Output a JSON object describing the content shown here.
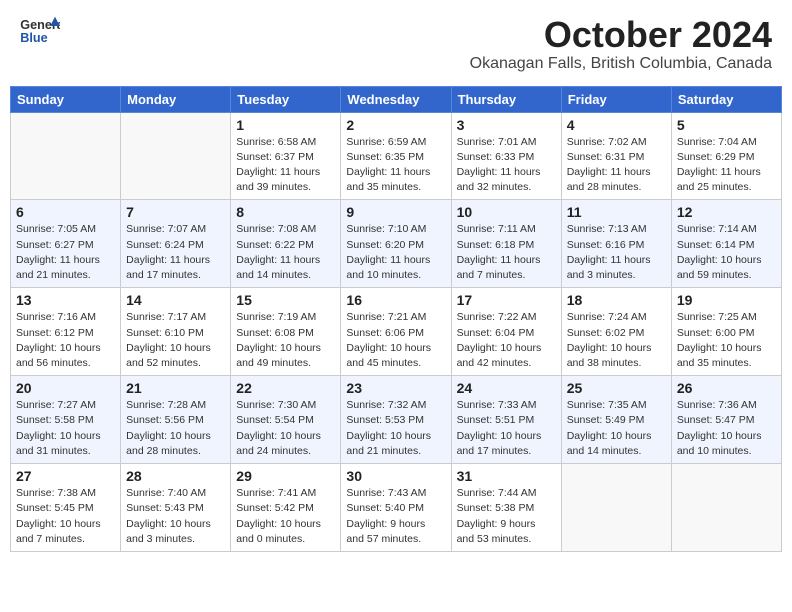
{
  "header": {
    "logo_general": "General",
    "logo_blue": "Blue",
    "month_title": "October 2024",
    "location": "Okanagan Falls, British Columbia, Canada"
  },
  "days_of_week": [
    "Sunday",
    "Monday",
    "Tuesday",
    "Wednesday",
    "Thursday",
    "Friday",
    "Saturday"
  ],
  "weeks": [
    [
      {
        "day": "",
        "info": ""
      },
      {
        "day": "",
        "info": ""
      },
      {
        "day": "1",
        "info": "Sunrise: 6:58 AM\nSunset: 6:37 PM\nDaylight: 11 hours and 39 minutes."
      },
      {
        "day": "2",
        "info": "Sunrise: 6:59 AM\nSunset: 6:35 PM\nDaylight: 11 hours and 35 minutes."
      },
      {
        "day": "3",
        "info": "Sunrise: 7:01 AM\nSunset: 6:33 PM\nDaylight: 11 hours and 32 minutes."
      },
      {
        "day": "4",
        "info": "Sunrise: 7:02 AM\nSunset: 6:31 PM\nDaylight: 11 hours and 28 minutes."
      },
      {
        "day": "5",
        "info": "Sunrise: 7:04 AM\nSunset: 6:29 PM\nDaylight: 11 hours and 25 minutes."
      }
    ],
    [
      {
        "day": "6",
        "info": "Sunrise: 7:05 AM\nSunset: 6:27 PM\nDaylight: 11 hours and 21 minutes."
      },
      {
        "day": "7",
        "info": "Sunrise: 7:07 AM\nSunset: 6:24 PM\nDaylight: 11 hours and 17 minutes."
      },
      {
        "day": "8",
        "info": "Sunrise: 7:08 AM\nSunset: 6:22 PM\nDaylight: 11 hours and 14 minutes."
      },
      {
        "day": "9",
        "info": "Sunrise: 7:10 AM\nSunset: 6:20 PM\nDaylight: 11 hours and 10 minutes."
      },
      {
        "day": "10",
        "info": "Sunrise: 7:11 AM\nSunset: 6:18 PM\nDaylight: 11 hours and 7 minutes."
      },
      {
        "day": "11",
        "info": "Sunrise: 7:13 AM\nSunset: 6:16 PM\nDaylight: 11 hours and 3 minutes."
      },
      {
        "day": "12",
        "info": "Sunrise: 7:14 AM\nSunset: 6:14 PM\nDaylight: 10 hours and 59 minutes."
      }
    ],
    [
      {
        "day": "13",
        "info": "Sunrise: 7:16 AM\nSunset: 6:12 PM\nDaylight: 10 hours and 56 minutes."
      },
      {
        "day": "14",
        "info": "Sunrise: 7:17 AM\nSunset: 6:10 PM\nDaylight: 10 hours and 52 minutes."
      },
      {
        "day": "15",
        "info": "Sunrise: 7:19 AM\nSunset: 6:08 PM\nDaylight: 10 hours and 49 minutes."
      },
      {
        "day": "16",
        "info": "Sunrise: 7:21 AM\nSunset: 6:06 PM\nDaylight: 10 hours and 45 minutes."
      },
      {
        "day": "17",
        "info": "Sunrise: 7:22 AM\nSunset: 6:04 PM\nDaylight: 10 hours and 42 minutes."
      },
      {
        "day": "18",
        "info": "Sunrise: 7:24 AM\nSunset: 6:02 PM\nDaylight: 10 hours and 38 minutes."
      },
      {
        "day": "19",
        "info": "Sunrise: 7:25 AM\nSunset: 6:00 PM\nDaylight: 10 hours and 35 minutes."
      }
    ],
    [
      {
        "day": "20",
        "info": "Sunrise: 7:27 AM\nSunset: 5:58 PM\nDaylight: 10 hours and 31 minutes."
      },
      {
        "day": "21",
        "info": "Sunrise: 7:28 AM\nSunset: 5:56 PM\nDaylight: 10 hours and 28 minutes."
      },
      {
        "day": "22",
        "info": "Sunrise: 7:30 AM\nSunset: 5:54 PM\nDaylight: 10 hours and 24 minutes."
      },
      {
        "day": "23",
        "info": "Sunrise: 7:32 AM\nSunset: 5:53 PM\nDaylight: 10 hours and 21 minutes."
      },
      {
        "day": "24",
        "info": "Sunrise: 7:33 AM\nSunset: 5:51 PM\nDaylight: 10 hours and 17 minutes."
      },
      {
        "day": "25",
        "info": "Sunrise: 7:35 AM\nSunset: 5:49 PM\nDaylight: 10 hours and 14 minutes."
      },
      {
        "day": "26",
        "info": "Sunrise: 7:36 AM\nSunset: 5:47 PM\nDaylight: 10 hours and 10 minutes."
      }
    ],
    [
      {
        "day": "27",
        "info": "Sunrise: 7:38 AM\nSunset: 5:45 PM\nDaylight: 10 hours and 7 minutes."
      },
      {
        "day": "28",
        "info": "Sunrise: 7:40 AM\nSunset: 5:43 PM\nDaylight: 10 hours and 3 minutes."
      },
      {
        "day": "29",
        "info": "Sunrise: 7:41 AM\nSunset: 5:42 PM\nDaylight: 10 hours and 0 minutes."
      },
      {
        "day": "30",
        "info": "Sunrise: 7:43 AM\nSunset: 5:40 PM\nDaylight: 9 hours and 57 minutes."
      },
      {
        "day": "31",
        "info": "Sunrise: 7:44 AM\nSunset: 5:38 PM\nDaylight: 9 hours and 53 minutes."
      },
      {
        "day": "",
        "info": ""
      },
      {
        "day": "",
        "info": ""
      }
    ]
  ]
}
